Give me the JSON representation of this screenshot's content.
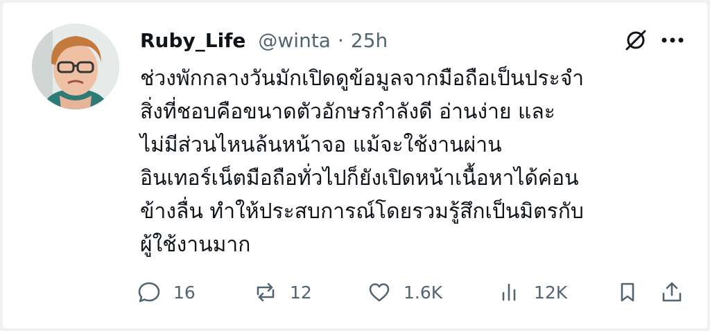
{
  "post": {
    "display_name": "Ruby_Life",
    "handle": "@winta",
    "separator": "·",
    "timestamp": "25h",
    "text_lines": [
      "ช่วงพักกลางวันมักเปิดดูข้อมูลจากมือถือเป็นประจำ",
      "สิ่งที่ชอบคือขนาดตัวอักษรกำลังดี อ่านง่าย และ",
      "ไม่มีส่วนไหนล้นหน้าจอ แม้จะใช้งานผ่าน",
      "อินเทอร์เน็ตมือถือทั่วไปก็ยังเปิดหน้าเนื้อหาได้ค่อน",
      "ข้างลื่น ทำให้ประสบการณ์โดยรวมรู้สึกเป็นมิตรกับ",
      "ผู้ใช้งานมาก"
    ]
  },
  "actions": {
    "reply_count": "16",
    "repost_count": "12",
    "like_count": "1.6K",
    "views_count": "12K"
  },
  "icons": {
    "grok": "grok-icon",
    "more": "more-icon",
    "reply": "reply-icon",
    "repost": "repost-icon",
    "like": "like-icon",
    "views": "views-icon",
    "bookmark": "bookmark-icon",
    "share": "share-icon"
  },
  "colors": {
    "text": "#0f1419",
    "muted": "#536471",
    "background": "#ffffff"
  }
}
